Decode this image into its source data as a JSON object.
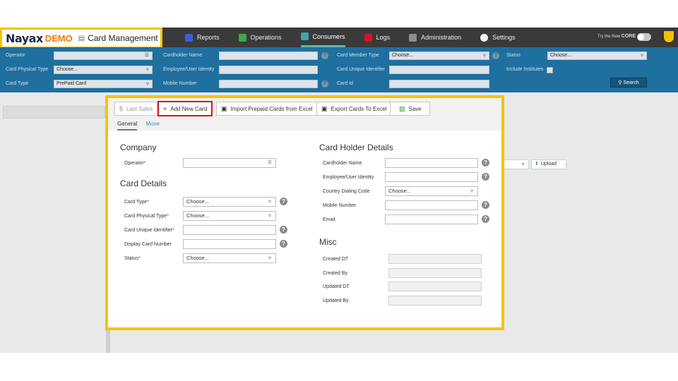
{
  "brand": {
    "logo": "Nayax",
    "demo": "DEMO",
    "icon": "card-management-icon",
    "title": "Card Management"
  },
  "nav": [
    {
      "label": "Reports",
      "icon": "reports-icon",
      "color": "#3f5bd6"
    },
    {
      "label": "Operations",
      "icon": "operations-icon",
      "color": "#3fa84a"
    },
    {
      "label": "Consumers",
      "icon": "consumers-icon",
      "color": "#3aa6b4"
    },
    {
      "label": "Logs",
      "icon": "logs-icon",
      "color": "#d9132a"
    },
    {
      "label": "Administration",
      "icon": "administration-icon",
      "color": "#8e8e8e"
    },
    {
      "label": "Settings",
      "icon": "settings-icon",
      "color": "#f2f2f2"
    }
  ],
  "try_new": {
    "prefix": "Try the New",
    "brand": "CORE"
  },
  "filters": {
    "operator_label": "Operator",
    "card_physical_type_label": "Card Physical Type",
    "card_physical_type_value": "Choose...",
    "card_type_label": "Card Type",
    "card_type_value": "PrePaid Card",
    "cardholder_name_label": "Cardholder Name",
    "employee_identity_label": "Employee/User Identity",
    "mobile_number_label": "Mobile Number",
    "card_member_type_label": "Card Member Type",
    "card_member_type_value": "Choose...",
    "card_unique_identifier_label": "Card Unique Identifier",
    "card_id_label": "Card Id",
    "status_label": "Status",
    "status_value": "Choose...",
    "include_institutes_label": "Include Institutes",
    "search_label": "Search",
    "help_glyph": "?"
  },
  "toolbar": {
    "last_sales": "Last Sales",
    "add_new_card": "Add New Card",
    "import_prepaid": "Import Prepaid Cards from Excel",
    "export_cards": "Export Cards To Excel",
    "save": "Save"
  },
  "tabs": [
    "General",
    "Move"
  ],
  "company": {
    "title": "Company",
    "operator_label": "Operator"
  },
  "card_details": {
    "title": "Card Details",
    "card_type_label": "Card Type",
    "card_type_value": "Choose...",
    "card_physical_type_label": "Card Physical Type",
    "card_physical_type_value": "Choose...",
    "card_unique_identifier_label": "Card Unique Identifier",
    "display_card_number_label": "Display Card Number",
    "status_label": "Status",
    "status_value": "Choose..."
  },
  "card_holder": {
    "title": "Card Holder Details",
    "cardholder_name_label": "Cardholder Name",
    "employee_identity_label": "Employee/User Identity",
    "country_dialing_code_label": "Country Dialing Code",
    "country_dialing_code_value": "Choose...",
    "mobile_number_label": "Mobile Number",
    "email_label": "Email"
  },
  "misc": {
    "title": "Misc",
    "created_dt_label": "Created DT",
    "created_by_label": "Created By",
    "updated_dt_label": "Updated DT",
    "updated_by_label": "Updated By"
  },
  "upload": {
    "clear_glyph": "×",
    "label": "Upload"
  },
  "colors": {
    "highlight": "#f5c400",
    "add_card_outline": "#d9132a",
    "filter_bar": "#1f6f9f"
  }
}
